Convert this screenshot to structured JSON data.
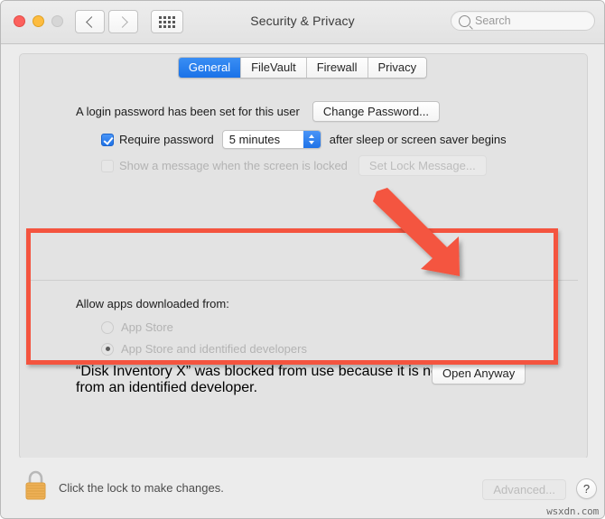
{
  "window": {
    "title": "Security & Privacy",
    "traffic_lights": [
      "close",
      "minimize",
      "zoom"
    ],
    "nav": {
      "back": "back-chevron",
      "forward": "forward-chevron",
      "show_all": "grid-icon"
    },
    "search": {
      "placeholder": "Search",
      "value": "",
      "icon": "search-icon"
    }
  },
  "tabs": [
    {
      "label": "General",
      "active": true
    },
    {
      "label": "FileVault",
      "active": false
    },
    {
      "label": "Firewall",
      "active": false
    },
    {
      "label": "Privacy",
      "active": false
    }
  ],
  "general": {
    "login_password_text": "A login password has been set for this user",
    "change_password_button": "Change Password...",
    "require_password": {
      "checked": true,
      "label": "Require password",
      "delay_value": "5 minutes",
      "suffix": "after sleep or screen saver begins"
    },
    "lock_message": {
      "checked": false,
      "label": "Show a message when the screen is locked",
      "button": "Set Lock Message...",
      "disabled": true
    }
  },
  "allow_apps": {
    "heading": "Allow apps downloaded from:",
    "options": [
      {
        "label": "App Store",
        "selected": false,
        "disabled": true
      },
      {
        "label": "App Store and identified developers",
        "selected": true,
        "disabled": true
      }
    ],
    "blocked_message": "“Disk Inventory X” was blocked from use because it is not from an identified developer.",
    "open_anyway_button": "Open Anyway"
  },
  "bottom": {
    "lock_icon": "closed-padlock-icon",
    "lock_text": "Click the lock to make changes.",
    "advanced_button": "Advanced...",
    "help_button": "?"
  },
  "annotations": {
    "arrow": "red-arrow-pointing-down-right",
    "highlight_box": "red-highlight-rectangle",
    "accent_color": "#f4543f"
  },
  "watermark": "wsxdn.com"
}
